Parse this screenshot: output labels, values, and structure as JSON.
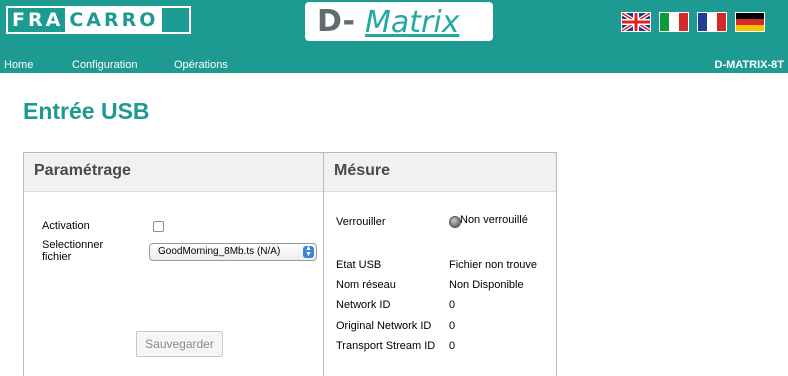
{
  "header": {
    "brand_left": "FRA",
    "brand_right": "CARRO",
    "logo_d": "D-",
    "logo_matrix": "Matrix",
    "device_name": "D-MATRIX-8T",
    "flags": [
      "uk-flag-icon",
      "it-flag-icon",
      "fr-flag-icon",
      "de-flag-icon"
    ]
  },
  "nav": {
    "home": "Home",
    "configuration": "Configuration",
    "operations": "Opérations"
  },
  "page_title": "Entrée USB",
  "settings": {
    "title": "Paramétrage",
    "activation_label": "Activation",
    "activation_checked": false,
    "select_label_line1": "Selectionner",
    "select_label_line2": "fichier",
    "selected_file": "GoodMorning_8Mb.ts (N/A)",
    "save_label": "Sauvegarder"
  },
  "measure": {
    "title": "Mésure",
    "lock_label": "Verrouiller",
    "lock_value": "Non verrouillé",
    "rows": [
      {
        "label": "Etat USB",
        "value": "Fichier non trouve"
      },
      {
        "label": "Nom réseau",
        "value": "Non Disponible"
      },
      {
        "label": "Network ID",
        "value": "0"
      },
      {
        "label": "Original Network ID",
        "value": "0"
      },
      {
        "label": "Transport Stream ID",
        "value": "0"
      }
    ]
  },
  "colors": {
    "accent": "#1d9a92",
    "logo_text": "#22aaa0"
  }
}
